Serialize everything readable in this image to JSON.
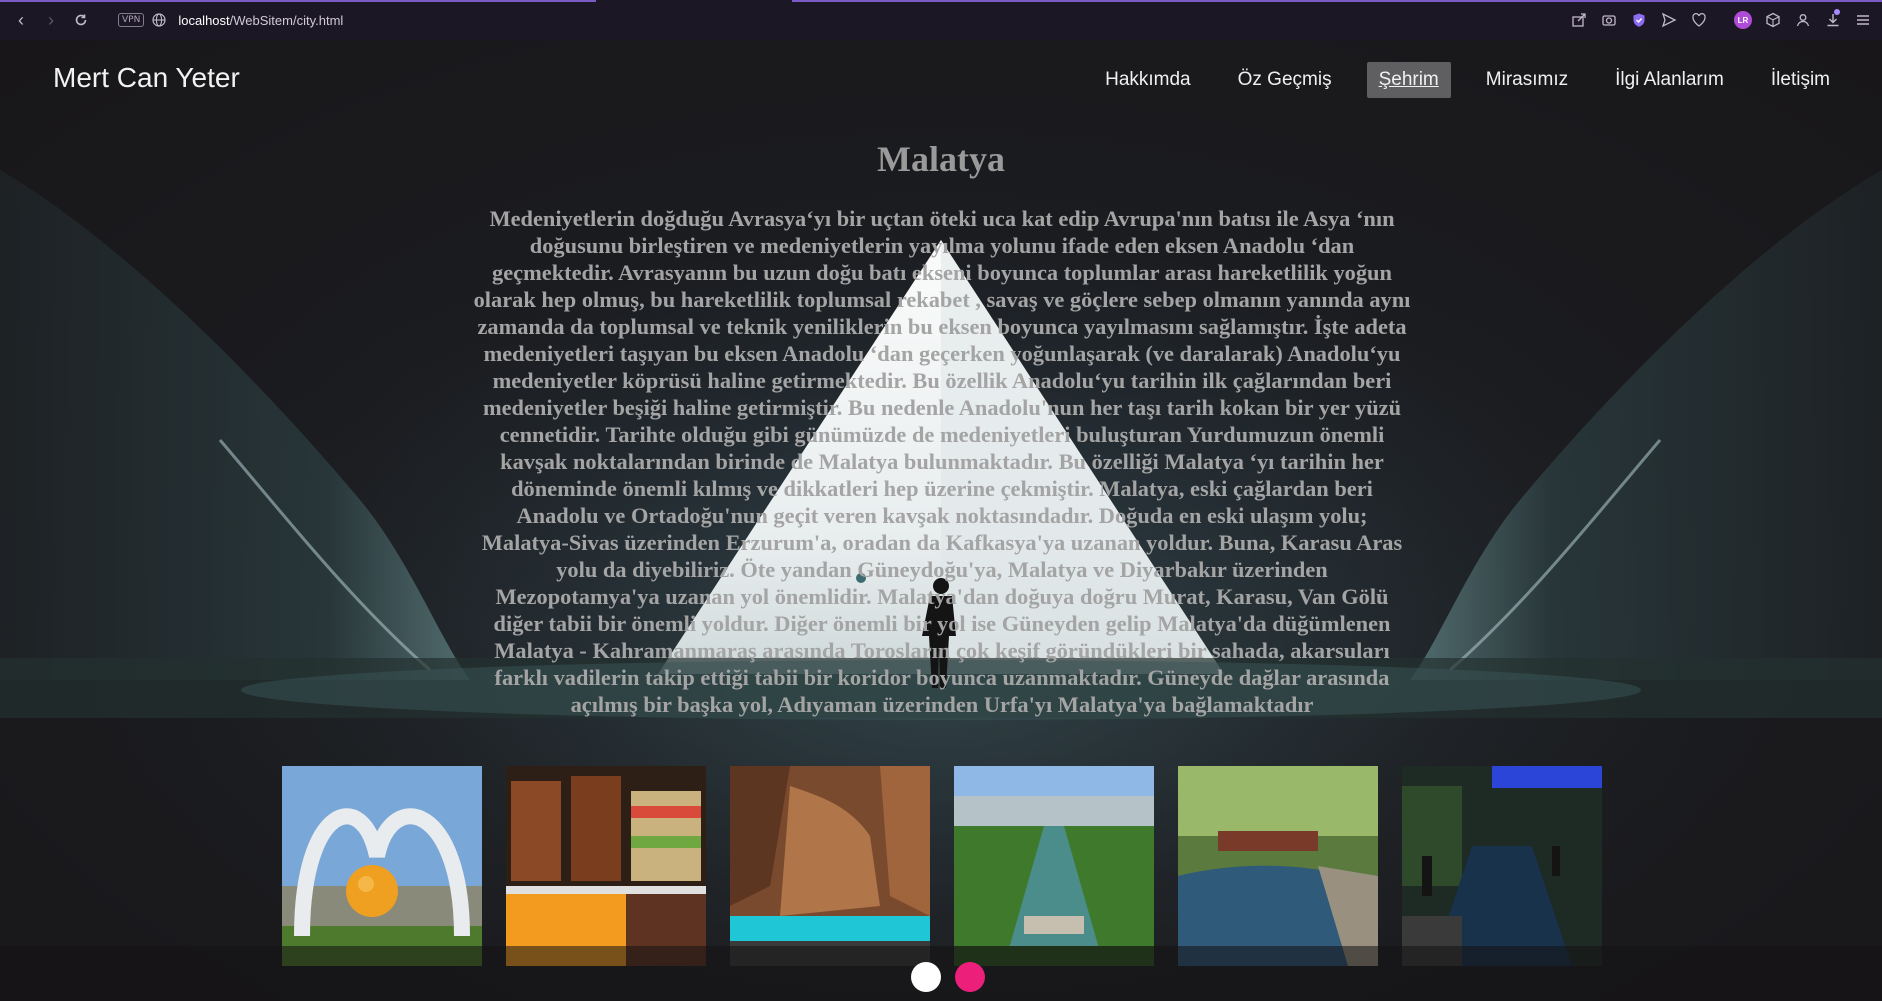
{
  "browser": {
    "vpn_label": "VPN",
    "url_host": "localhost",
    "url_path": "/WebSitem/city.html",
    "profile_initials": "LR"
  },
  "site": {
    "brand": "Mert Can Yeter",
    "nav": [
      {
        "label": "Hakkımda",
        "active": false
      },
      {
        "label": "Öz Geçmiş",
        "active": false
      },
      {
        "label": "Şehrim",
        "active": true
      },
      {
        "label": "Mirasımız",
        "active": false
      },
      {
        "label": "İlgi Alanlarım",
        "active": false
      },
      {
        "label": "İletişim",
        "active": false
      }
    ]
  },
  "main": {
    "title": "Malatya",
    "paragraph": "Medeniyetlerin doğduğu Avrasya‘yı bir uçtan öteki uca kat edip Avrupa'nın batısı ile Asya ‘nın doğusunu birleştiren ve medeniyetlerin yayılma yolunu ifade eden eksen Anadolu ‘dan geçmektedir. Avrasyanın bu uzun doğu batı ekseni boyunca toplumlar arası hareketlilik yoğun olarak hep olmuş, bu hareketlilik toplumsal rekabet , savaş ve göçlere sebep olmanın yanında aynı zamanda da toplumsal ve teknik yeniliklerin bu eksen boyunca yayılmasını sağlamıştır. İşte adeta medeniyetleri taşıyan bu eksen Anadolu ‘dan geçerken yoğunlaşarak (ve daralarak) Anadolu‘yu medeniyetler köprüsü haline getirmektedir. Bu özellik Anadolu‘yu tarihin ilk çağlarından beri medeniyetler beşiği haline getirmiştir. Bu nedenle Anadolu'nun her taşı tarih kokan bir yer yüzü cennetidir. Tarihte olduğu gibi günümüzde de medeniyetleri buluşturan Yurdumuzun önemli kavşak noktalarından birinde de Malatya bulunmaktadır. Bu özelliği Malatya ‘yı tarihin her döneminde önemli kılmış ve dikkatleri hep üzerine çekmiştir. Malatya, eski çağlardan beri Anadolu ve Ortadoğu'nun geçit veren kavşak noktasındadır. Doğuda en eski ulaşım yolu; Malatya-Sivas üzerinden Erzurum'a, oradan da Kafkasya'ya uzanan yoldur. Buna, Karasu Aras yolu da diyebiliriz. Öte yandan Güneydoğu'ya, Malatya ve Diyarbakır üzerinden Mezopotamya'ya uzanan yol önemlidir. Malatya'dan doğuya doğru Murat, Karasu, Van Gölü diğer tabii bir önemli yoldur. Diğer önemli bir yol ise Güneyden gelip Malatya'da düğümlenen Malatya - Kahramanmaraş arasında Torosların çok keşif göründükleri bir sahada, akarsuları farklı vadilerin takip ettiği tabii bir koridor boyunca uzanmaktadır. Güneyde dağlar arasında açılmış bir başka yol, Adıyaman üzerinden Urfa'yı Malatya'ya bağlamaktadır"
  },
  "gallery": {
    "photos": [
      {
        "subject": "apricot-monument"
      },
      {
        "subject": "dried-fruits-market"
      },
      {
        "subject": "canyon-waterfall"
      },
      {
        "subject": "park-canals"
      },
      {
        "subject": "river-cafe"
      },
      {
        "subject": "night-canal-street"
      }
    ],
    "carousel_dots": [
      {
        "color": "#ffffff",
        "active": false
      },
      {
        "color": "#ec1f7a",
        "active": true
      }
    ]
  }
}
